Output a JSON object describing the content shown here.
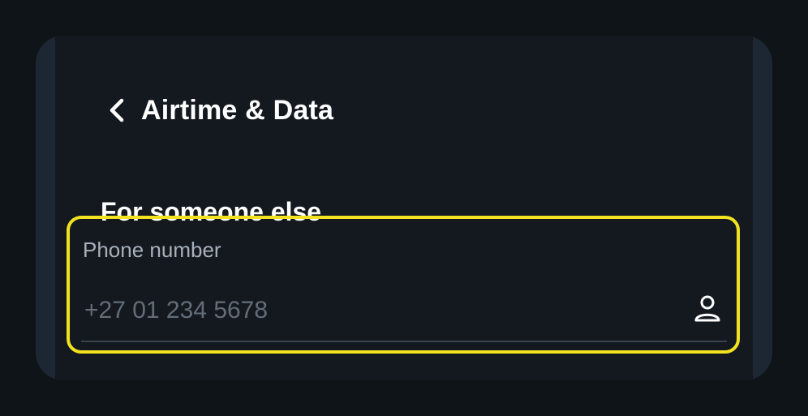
{
  "header": {
    "title": "Airtime & Data",
    "back_icon": "chevron-left-icon"
  },
  "section": {
    "title": "For someone else"
  },
  "phone_field": {
    "label": "Phone number",
    "placeholder": "+27 01 234 5678",
    "value": "",
    "icon": "person-icon"
  },
  "colors": {
    "background": "#0f1418",
    "screen": "#141920",
    "frame": "#1d2733",
    "highlight": "#f2e21f",
    "label": "#a7b0bb",
    "placeholder": "#636d78",
    "underline": "#39414b"
  }
}
